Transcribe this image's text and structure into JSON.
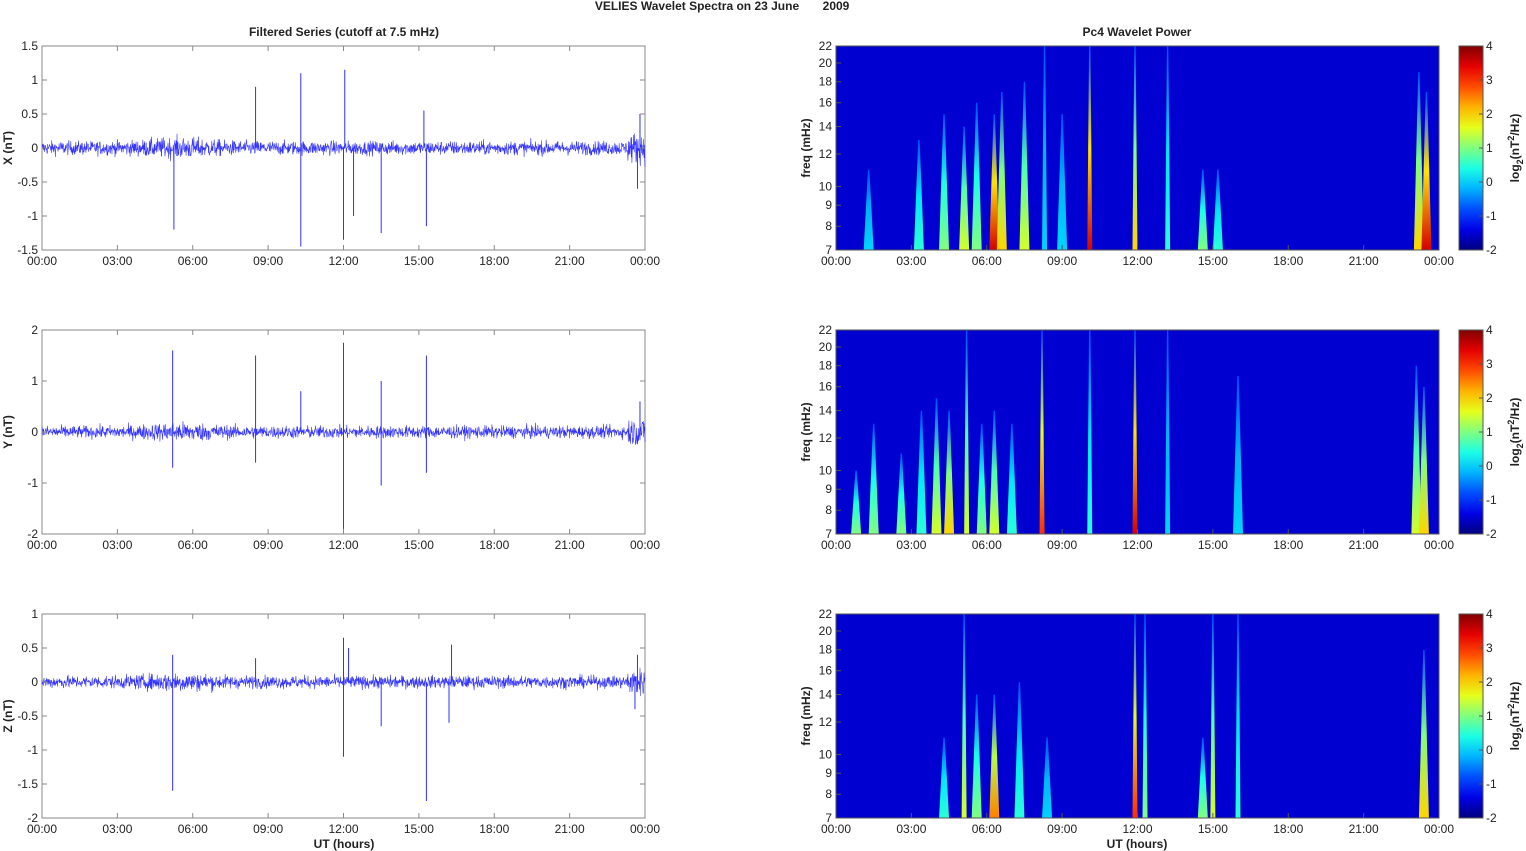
{
  "chart_data": {
    "type": "line",
    "title": "VELIES Wavelet Spectra on 23 June      2009",
    "title_parts": [
      "VELIES Wavelet Spectra on 23 June",
      "2009"
    ],
    "left_title": "Filtered Series (cutoff at 7.5 mHz)",
    "right_title": "Pc4 Wavelet Power",
    "xlabel": "UT (hours)",
    "x_ticks": [
      "00:00",
      "03:00",
      "06:00",
      "09:00",
      "12:00",
      "15:00",
      "18:00",
      "21:00",
      "00:00"
    ],
    "xlim": [
      0,
      24
    ],
    "freq_label": "freq (mHz)",
    "freq_ticks": [
      7,
      8,
      9,
      10,
      12,
      14,
      16,
      18,
      20,
      22
    ],
    "freq_lim": [
      7,
      22
    ],
    "colorbar": {
      "label": "log2(nT2/Hz)",
      "ticks": [
        -2,
        -1,
        0,
        1,
        2,
        3,
        4
      ],
      "lim": [
        -2,
        4
      ],
      "colormap": "jet"
    },
    "series": [
      {
        "name": "X",
        "ylabel": "X (nT)",
        "ylim": [
          -1.5,
          1.5
        ],
        "yticks": [
          -1.5,
          -1,
          -0.5,
          0,
          0.5,
          1,
          1.5
        ],
        "noise_amp": 0.1,
        "spikes": [
          [
            5.25,
            -1.2
          ],
          [
            8.5,
            0.9
          ],
          [
            10.3,
            1.1
          ],
          [
            10.3,
            -1.45
          ],
          [
            12.05,
            1.15
          ],
          [
            12.0,
            -1.35
          ],
          [
            12.4,
            -1.0
          ],
          [
            13.5,
            -1.25
          ],
          [
            15.3,
            -1.15
          ],
          [
            15.2,
            0.55
          ],
          [
            23.7,
            -0.6
          ],
          [
            23.8,
            0.5
          ]
        ],
        "bursts": [
          [
            1.3,
            0,
            11
          ],
          [
            3.3,
            0.5,
            13
          ],
          [
            4.3,
            1,
            15
          ],
          [
            5.1,
            1.5,
            14
          ],
          [
            5.6,
            1,
            16
          ],
          [
            6.3,
            3.5,
            15
          ],
          [
            6.6,
            2,
            17
          ],
          [
            7.5,
            1.5,
            18
          ],
          [
            8.3,
            0,
            22
          ],
          [
            9.0,
            0,
            15
          ],
          [
            10.1,
            3.5,
            22
          ],
          [
            11.9,
            2,
            22
          ],
          [
            13.2,
            0.5,
            22
          ],
          [
            14.6,
            1,
            11
          ],
          [
            15.2,
            0.5,
            11
          ],
          [
            23.2,
            2,
            19
          ],
          [
            23.5,
            3.5,
            17
          ]
        ]
      },
      {
        "name": "Y",
        "ylabel": "Y (nT)",
        "ylim": [
          -2,
          2
        ],
        "yticks": [
          -2,
          -1,
          0,
          1,
          2
        ],
        "noise_amp": 0.12,
        "spikes": [
          [
            5.2,
            1.6
          ],
          [
            5.2,
            -0.7
          ],
          [
            8.5,
            1.5
          ],
          [
            8.5,
            -0.6
          ],
          [
            10.3,
            0.8
          ],
          [
            12.0,
            1.75
          ],
          [
            12.0,
            -1.9
          ],
          [
            13.5,
            1.0
          ],
          [
            13.5,
            -1.05
          ],
          [
            15.3,
            1.5
          ],
          [
            15.3,
            -0.8
          ],
          [
            23.8,
            0.6
          ]
        ],
        "bursts": [
          [
            0.8,
            1,
            10
          ],
          [
            1.5,
            1,
            13
          ],
          [
            2.6,
            1,
            11
          ],
          [
            3.4,
            0.5,
            14
          ],
          [
            4.0,
            1.5,
            15
          ],
          [
            4.5,
            2,
            14
          ],
          [
            5.2,
            1.5,
            22
          ],
          [
            5.8,
            1,
            13
          ],
          [
            6.3,
            1.5,
            14
          ],
          [
            7.0,
            0.5,
            13
          ],
          [
            8.2,
            3,
            22
          ],
          [
            10.1,
            0.5,
            22
          ],
          [
            11.9,
            3.5,
            22
          ],
          [
            13.2,
            0,
            22
          ],
          [
            16.0,
            0,
            17
          ],
          [
            23.1,
            1.5,
            18
          ],
          [
            23.4,
            2,
            16
          ]
        ]
      },
      {
        "name": "Z",
        "ylabel": "Z (nT)",
        "ylim": [
          -2,
          1
        ],
        "yticks": [
          -2,
          -1.5,
          -1,
          -0.5,
          0,
          0.5,
          1
        ],
        "noise_amp": 0.09,
        "spikes": [
          [
            5.2,
            -1.6
          ],
          [
            5.2,
            0.4
          ],
          [
            8.5,
            0.35
          ],
          [
            12.0,
            0.65
          ],
          [
            12.0,
            -1.1
          ],
          [
            12.2,
            0.5
          ],
          [
            13.5,
            -0.65
          ],
          [
            15.3,
            -1.75
          ],
          [
            16.3,
            0.55
          ],
          [
            16.2,
            -0.6
          ],
          [
            23.7,
            0.4
          ],
          [
            23.6,
            -0.4
          ]
        ],
        "bursts": [
          [
            4.3,
            0.5,
            11
          ],
          [
            5.1,
            1.5,
            22
          ],
          [
            5.6,
            1,
            14
          ],
          [
            6.3,
            2.5,
            14
          ],
          [
            7.3,
            0.5,
            15
          ],
          [
            8.4,
            0,
            11
          ],
          [
            11.9,
            3,
            22
          ],
          [
            12.3,
            1,
            22
          ],
          [
            14.6,
            1,
            11
          ],
          [
            15.0,
            1.5,
            22
          ],
          [
            16.0,
            0.5,
            22
          ],
          [
            23.4,
            2,
            18
          ]
        ]
      }
    ]
  }
}
